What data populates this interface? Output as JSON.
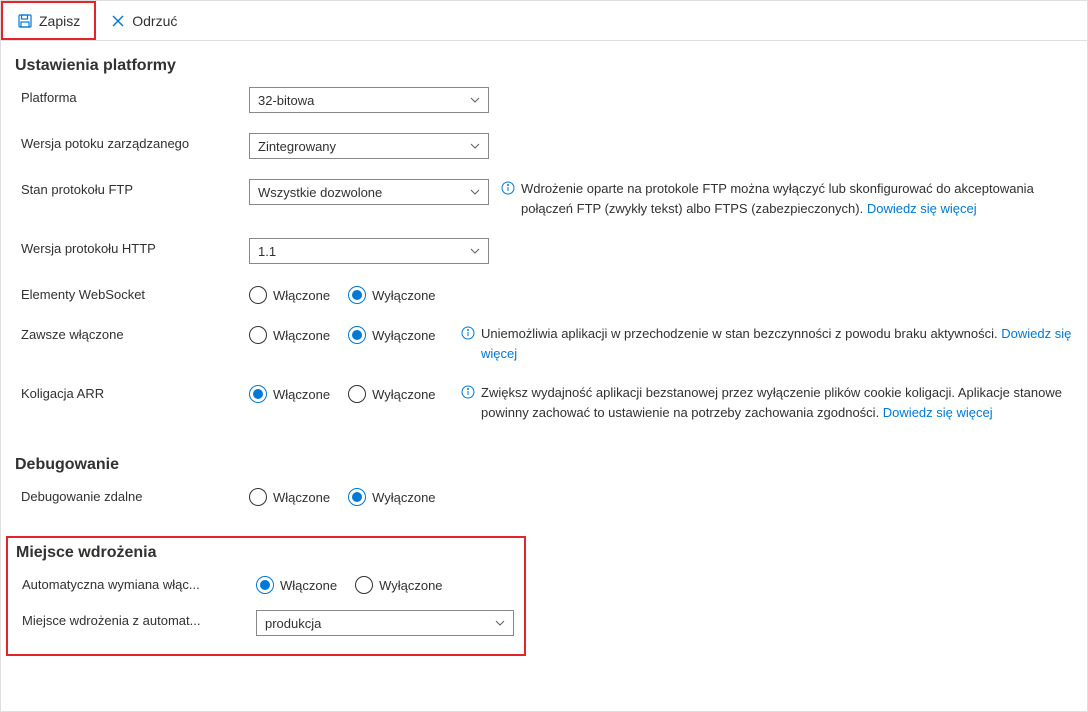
{
  "toolbar": {
    "save_label": "Zapisz",
    "discard_label": "Odrzuć"
  },
  "sections": {
    "platform_title": "Ustawienia platformy",
    "debugging_title": "Debugowanie",
    "deployment_title": "Miejsce wdrożenia"
  },
  "labels": {
    "platform": "Platforma",
    "pipeline_version": "Wersja potoku zarządzanego",
    "ftp_state": "Stan protokołu FTP",
    "http_version": "Wersja protokołu HTTP",
    "websockets": "Elementy WebSocket",
    "always_on": "Zawsze włączone",
    "arr_affinity": "Koligacja ARR",
    "remote_debugging": "Debugowanie zdalne",
    "auto_swap": "Automatyczna wymiana włąc...",
    "auto_swap_slot": "Miejsce wdrożenia z automat..."
  },
  "values": {
    "platform": "32-bitowa",
    "pipeline_version": "Zintegrowany",
    "ftp_state": "Wszystkie dozwolone",
    "http_version": "1.1",
    "auto_swap_slot": "produkcja"
  },
  "radio": {
    "on": "Włączone",
    "off": "Wyłączone"
  },
  "descriptions": {
    "ftp_text": "Wdrożenie oparte na protokole FTP można wyłączyć lub skonfigurować do akceptowania połączeń FTP (zwykły tekst) albo FTPS (zabezpieczonych). ",
    "ftp_link": "Dowiedz się więcej",
    "always_on_text": "Uniemożliwia aplikacji w przechodzenie w stan bezczynności z powodu braku aktywności. ",
    "always_on_link": "Dowiedz się więcej",
    "arr_text": "Zwiększ wydajność aplikacji bezstanowej przez wyłączenie plików cookie koligacji. Aplikacje stanowe powinny zachować to ustawienie na potrzeby zachowania zgodności. ",
    "arr_link": "Dowiedz się więcej"
  }
}
